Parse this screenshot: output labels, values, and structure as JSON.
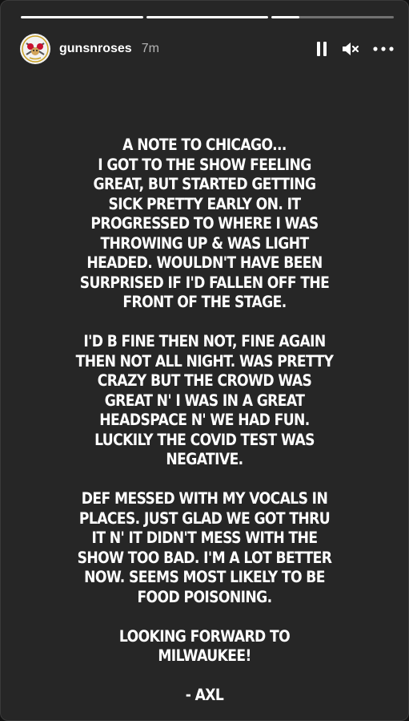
{
  "story": {
    "progress": [
      1.0,
      1.0,
      0.23
    ],
    "background_color": "#262626"
  },
  "header": {
    "username": "gunsnroses",
    "time": "7m",
    "avatar_icon": "gunsnroses-logo-icon",
    "controls": {
      "pause_icon": "pause-icon",
      "mute_icon": "speaker-muted-icon",
      "more_icon": "more-options-icon"
    }
  },
  "note": {
    "paragraphs": [
      "A NOTE TO CHICAGO...\nI GOT TO THE SHOW FEELING GREAT, BUT STARTED GETTING SICK PRETTY EARLY ON. IT PROGRESSED TO WHERE I WAS THROWING UP & WAS LIGHT HEADED. WOULDN'T HAVE BEEN SURPRISED IF I'D FALLEN OFF THE FRONT OF THE STAGE.",
      "I'D B FINE THEN NOT, FINE AGAIN THEN NOT ALL NIGHT. WAS PRETTY CRAZY BUT THE CROWD WAS GREAT N' I WAS IN A GREAT HEADSPACE N' WE HAD FUN. LUCKILY THE COVID TEST WAS NEGATIVE.",
      "DEF MESSED WITH MY VOCALS IN PLACES. JUST GLAD WE GOT THRU IT N' IT DIDN'T MESS WITH THE SHOW TOO BAD. I'M A LOT BETTER NOW. SEEMS MOST LIKELY TO BE FOOD POISONING.",
      "LOOKING FORWARD TO MILWAUKEE!",
      "- AXL"
    ]
  }
}
